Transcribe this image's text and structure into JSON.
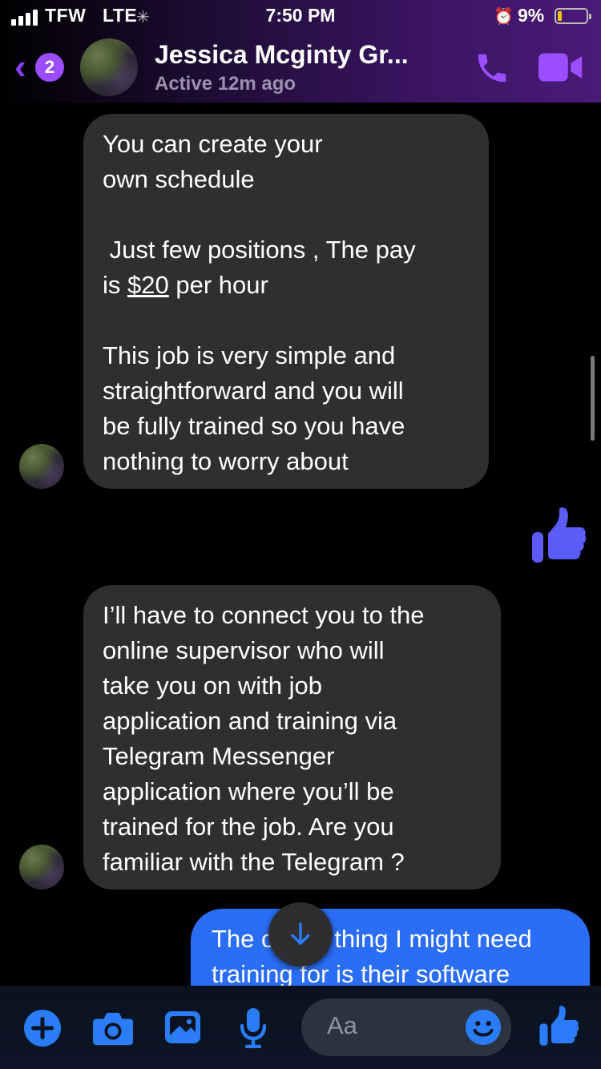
{
  "status_bar": {
    "carrier": "TFW",
    "network": "LTE",
    "time": "7:50 PM",
    "battery_percent": "9%",
    "signal_bars": 4
  },
  "header": {
    "back_badge": "2",
    "contact_name": "Jessica Mcginty Gr...",
    "active_status": "Active 12m ago",
    "icons": [
      "back-chevron-icon",
      "phone-icon",
      "video-camera-icon"
    ]
  },
  "messages": [
    {
      "sender": "contact",
      "lines_a": "You can create your\nown schedule\n\n Just few positions , The pay\nis ",
      "amount": "$20",
      "lines_b": " per hour\n\nThis job is very simple and\nstraightforward and you will\nbe fully trained so you have\nnothing to worry about"
    },
    {
      "sender": "me",
      "type": "thumbs-up",
      "icon": "thumbs-up-icon"
    },
    {
      "sender": "contact",
      "text": "I’ll have to connect you to the\nonline supervisor who will\ntake you on with job\napplication and training via\nTelegram Messenger\napplication where you’ll be\ntrained for the job. Are you\nfamiliar with the Telegram ?"
    },
    {
      "sender": "me",
      "text_partial_1": "The o",
      "text_partial_2": "thing I might need",
      "text_line2": "training for is their software"
    }
  ],
  "composer": {
    "placeholder": "Aa",
    "icons": [
      "plus-icon",
      "camera-icon",
      "gallery-icon",
      "microphone-icon",
      "emoji-icon",
      "thumbs-up-icon"
    ]
  },
  "colors": {
    "accent_purple": "#9b4dff",
    "composer_blue": "#2a7df6",
    "incoming_bubble": "#2f2f31",
    "outgoing_bubble": "#2a6df6"
  }
}
